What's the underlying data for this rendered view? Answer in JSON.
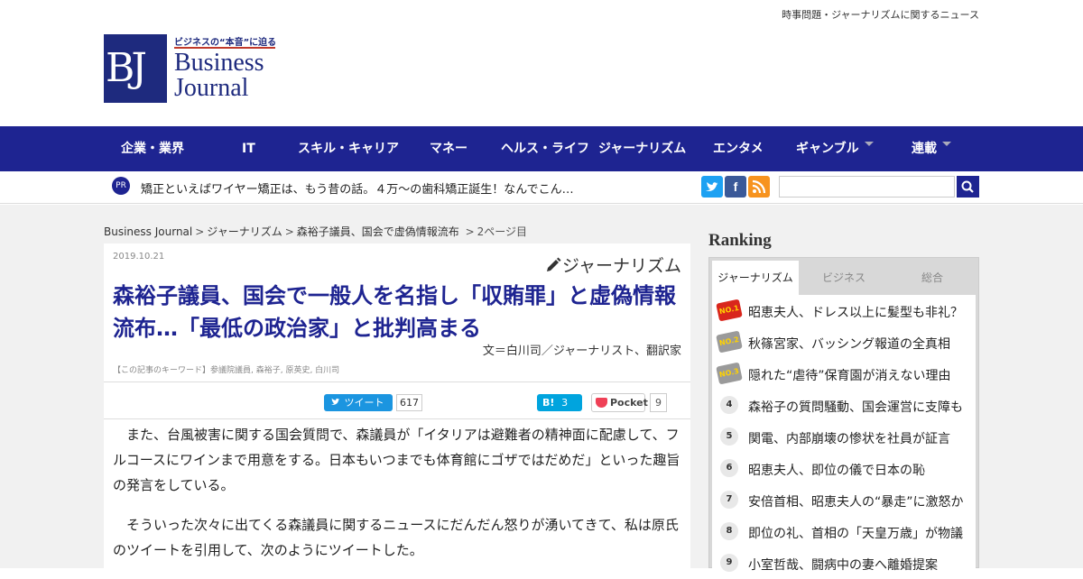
{
  "header": {
    "tagline": "時事問題・ジャーナリズムに関するニュース",
    "logo": {
      "mark": "BJ",
      "tag": "ビジネスの“本音”に迫る",
      "name_line1": "Business",
      "name_line2": "Journal"
    }
  },
  "nav": {
    "items": [
      {
        "label": "企業・業界",
        "dropdown": false
      },
      {
        "label": "IT",
        "dropdown": false
      },
      {
        "label": "スキル・キャリア",
        "dropdown": false
      },
      {
        "label": "マネー",
        "dropdown": false
      },
      {
        "label": "ヘルス・ライフ",
        "dropdown": false
      },
      {
        "label": "ジャーナリズム",
        "dropdown": false
      },
      {
        "label": "エンタメ",
        "dropdown": false
      },
      {
        "label": "ギャンブル",
        "dropdown": true
      },
      {
        "label": "連載",
        "dropdown": true
      }
    ]
  },
  "promo": {
    "badge": "PR",
    "text": "矯正といえばワイヤー矯正は、もう昔の話。４万～の歯科矯正誕生！なんでこん…"
  },
  "social_icons": [
    "twitter-icon",
    "facebook-icon",
    "rss-icon"
  ],
  "search": {
    "placeholder": ""
  },
  "breadcrumb": {
    "home": "Business Journal",
    "category": "ジャーナリズム",
    "article": "森裕子議員、国会で虚偽情報流布",
    "page": "2ページ目"
  },
  "article": {
    "date": "2019.10.21",
    "category": "ジャーナリズム",
    "title": "森裕子議員、国会で一般人を名指し「収賄罪」と虚偽情報流布…「最低の政治家」と批判高まる",
    "author": "文＝白川司／ジャーナリスト、翻訳家",
    "keywords": "【この記事のキーワード】参議院議員, 森裕子, 原英史, 白川司",
    "share": {
      "tweet_label": "ツイート",
      "tweet_count": "617",
      "hatena_label": "B!",
      "hatena_count": "3",
      "pocket_label": "Pocket",
      "pocket_count": "9"
    },
    "paragraphs": [
      "また、台風被害に関する国会質問で、森議員が「イタリアは避難者の精神面に配慮して、フルコースにワインまで用意をする。日本もいつまでも体育館にゴザではだめだ」といった趣旨の発言をしている。",
      "そういった次々に出てくる森議員に関するニュースにだんだん怒りが湧いてきて、私は原氏のツイートを引用して、次のようにツイートした。"
    ]
  },
  "ranking": {
    "title": "Ranking",
    "tabs": [
      {
        "label": "ジャーナリズム",
        "active": true
      },
      {
        "label": "ビジネス",
        "active": false
      },
      {
        "label": "総合",
        "active": false
      }
    ],
    "items": [
      {
        "rank": "NO.1",
        "text": "昭恵夫人、ドレス以上に髪型も非礼？"
      },
      {
        "rank": "NO.2",
        "text": "秋篠宮家、バッシング報道の全真相"
      },
      {
        "rank": "NO.3",
        "text": "隠れた“虐待”保育園が消えない理由"
      },
      {
        "rank": "4",
        "text": "森裕子の質問騒動、国会運営に支障も"
      },
      {
        "rank": "5",
        "text": "関電、内部崩壊の惨状を社員が証言"
      },
      {
        "rank": "6",
        "text": "昭恵夫人、即位の儀で日本の恥"
      },
      {
        "rank": "7",
        "text": "安倍首相、昭恵夫人の“暴走”に激怒か"
      },
      {
        "rank": "8",
        "text": "即位の礼、首相の「天皇万歳」が物議"
      },
      {
        "rank": "9",
        "text": "小室哲哉、闘病中の妻へ離婚提案"
      }
    ]
  }
}
